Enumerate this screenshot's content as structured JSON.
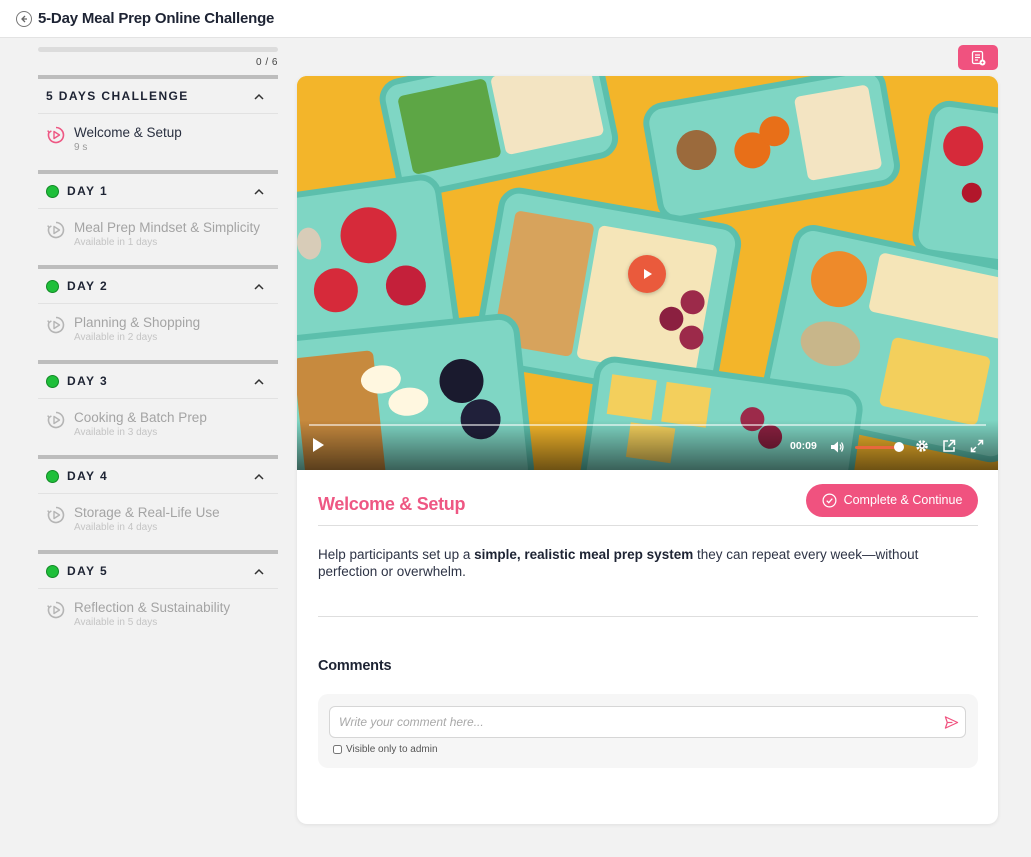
{
  "header": {
    "title": "5-Day Meal Prep Online Challenge",
    "back_icon": "back-circle-icon"
  },
  "progress": {
    "text": "0 / 6",
    "fraction": 0
  },
  "sidebar": {
    "sections": [
      {
        "title": "5 DAYS CHALLENGE",
        "completed": false,
        "lessons": [
          {
            "name": "Welcome & Setup",
            "sub": "9 s",
            "state": "active"
          }
        ]
      },
      {
        "title": "DAY 1",
        "completed": true,
        "lessons": [
          {
            "name": "Meal Prep Mindset & Simplicity",
            "sub": "Available in 1 days",
            "state": "locked"
          }
        ]
      },
      {
        "title": "DAY 2",
        "completed": true,
        "lessons": [
          {
            "name": "Planning & Shopping",
            "sub": "Available in 2 days",
            "state": "locked"
          }
        ]
      },
      {
        "title": "DAY 3",
        "completed": true,
        "lessons": [
          {
            "name": "Cooking & Batch Prep",
            "sub": "Available in 3 days",
            "state": "locked"
          }
        ]
      },
      {
        "title": "DAY 4",
        "completed": true,
        "lessons": [
          {
            "name": "Storage & Real-Life Use",
            "sub": "Available in 4 days",
            "state": "locked"
          }
        ]
      },
      {
        "title": "DAY 5",
        "completed": true,
        "lessons": [
          {
            "name": "Reflection & Sustainability",
            "sub": "Available in 5 days",
            "state": "locked"
          }
        ]
      }
    ]
  },
  "video": {
    "time": "00:09",
    "volume_fraction": 0.85,
    "progress_fraction": 0.0
  },
  "lesson": {
    "title": "Welcome & Setup",
    "complete_label": "Complete & Continue",
    "desc_before": "Help participants set up a ",
    "desc_bold": "simple, realistic meal prep system",
    "desc_after": " they can repeat every week—without perfection or overwhelm."
  },
  "comments": {
    "title": "Comments",
    "placeholder": "Write your comment here...",
    "visible_label": "Visible only to admin"
  },
  "colors": {
    "accent": "#f0527f",
    "title_pink": "#ee5783",
    "completed_green": "#1fbf3a",
    "video_accent": "#e8673d"
  }
}
